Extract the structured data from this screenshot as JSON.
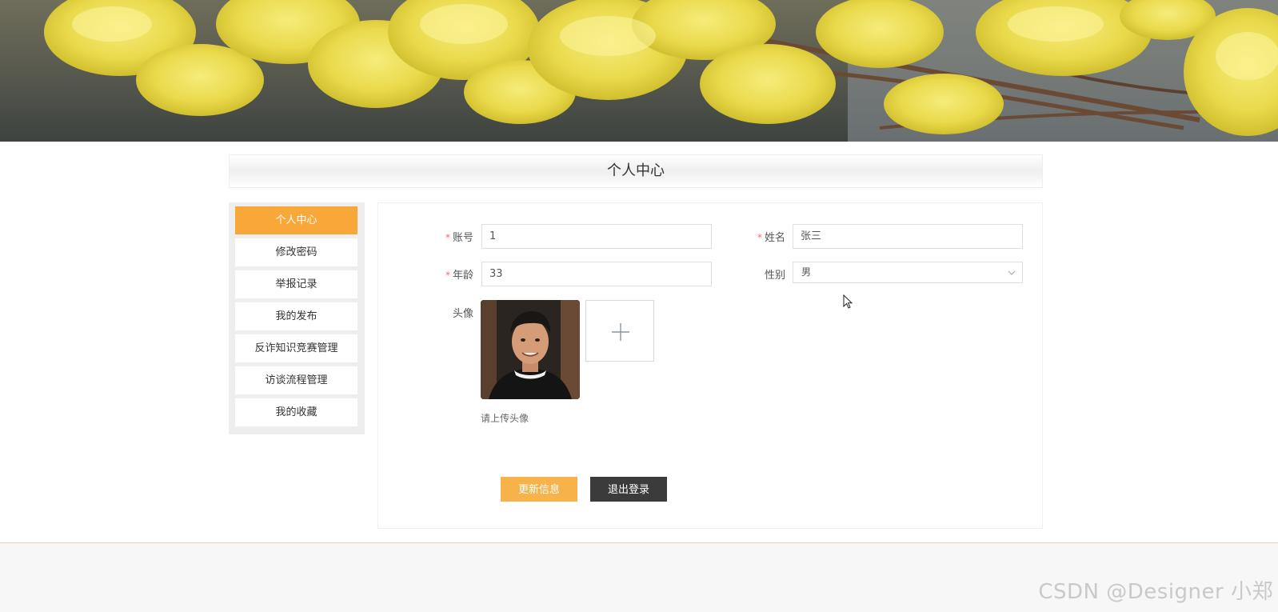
{
  "page": {
    "title": "个人中心"
  },
  "sidebar": {
    "items": [
      {
        "label": "个人中心",
        "active": true
      },
      {
        "label": "修改密码",
        "active": false
      },
      {
        "label": "举报记录",
        "active": false
      },
      {
        "label": "我的发布",
        "active": false
      },
      {
        "label": "反诈知识竞赛管理",
        "active": false
      },
      {
        "label": "访谈流程管理",
        "active": false
      },
      {
        "label": "我的收藏",
        "active": false
      }
    ]
  },
  "form": {
    "account": {
      "required_mark": "*",
      "label": "账号",
      "value": "1"
    },
    "name": {
      "required_mark": "*",
      "label": "姓名",
      "value": "张三"
    },
    "age": {
      "required_mark": "*",
      "label": "年龄",
      "value": "33"
    },
    "gender": {
      "label": "性别",
      "value": "男"
    },
    "avatar": {
      "label": "头像",
      "hint": "请上传头像"
    }
  },
  "buttons": {
    "update": "更新信息",
    "logout": "退出登录"
  },
  "footer": {
    "watermark": "CSDN @Designer 小郑"
  },
  "colors": {
    "accent": "#f7a838",
    "dark_button": "#3b3b3b",
    "required": "#f56c6c"
  },
  "icons": {
    "upload": "plus-icon",
    "select": "chevron-down-icon",
    "cursor": "mouse-cursor-icon"
  }
}
